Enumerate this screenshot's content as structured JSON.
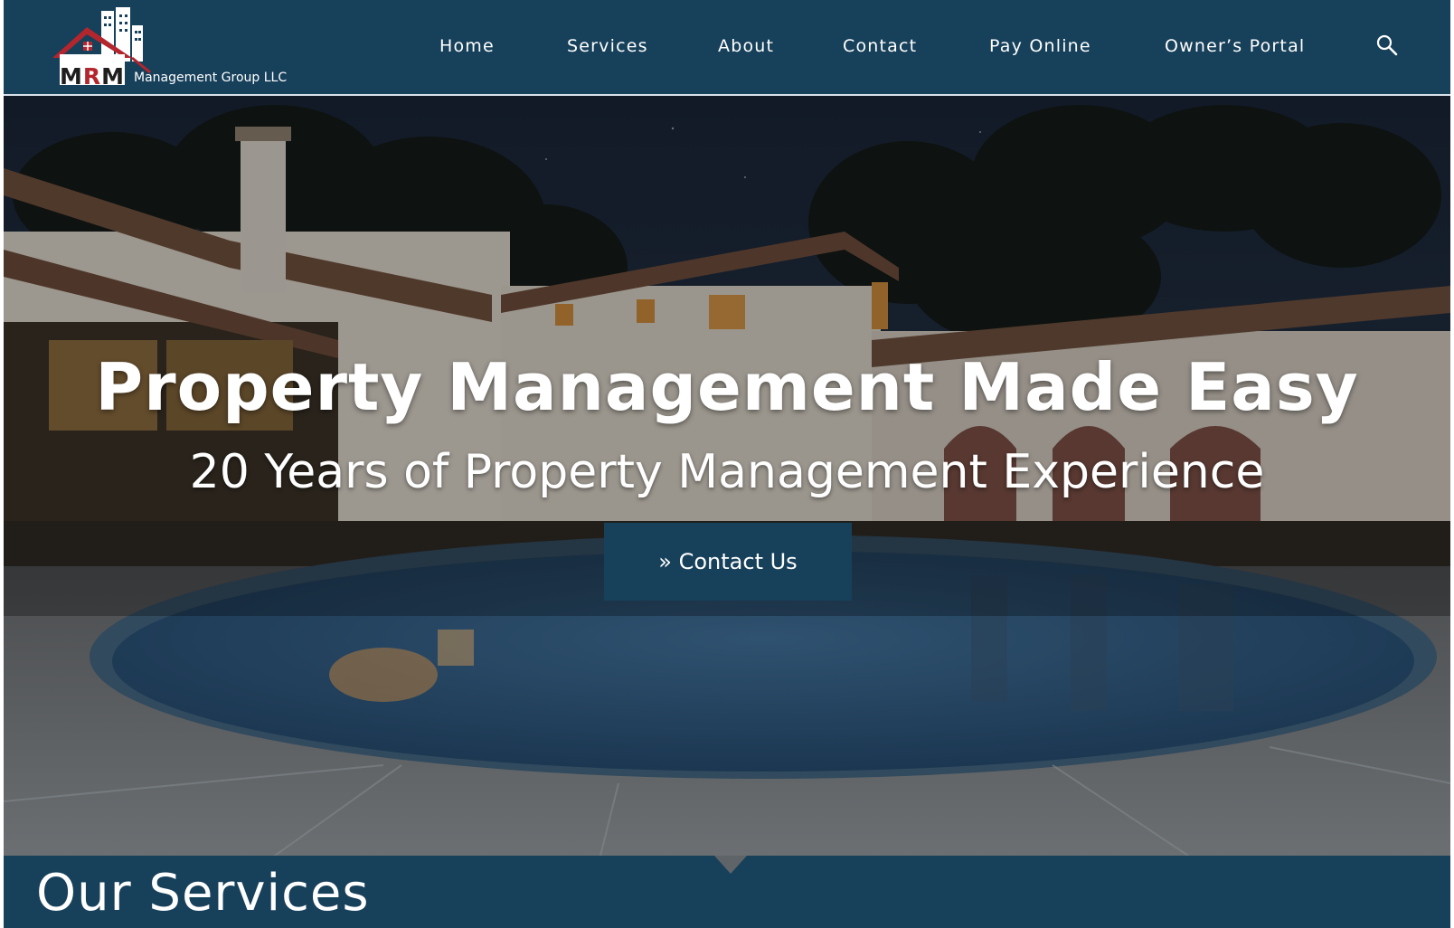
{
  "brand": {
    "initials": [
      "M",
      "R",
      "M"
    ],
    "tagline": "Management Group LLC",
    "colors": {
      "navy": "#17405a",
      "red": "#b3262d"
    }
  },
  "nav": {
    "items": [
      "Home",
      "Services",
      "About",
      "Contact",
      "Pay Online",
      "Owner’s Portal"
    ],
    "search_icon": "search-icon"
  },
  "hero": {
    "title": "Property Management Made Easy",
    "subtitle": "20 Years of Property Management Experience",
    "cta_label": "» Contact Us"
  },
  "services": {
    "title": "Our Services"
  }
}
